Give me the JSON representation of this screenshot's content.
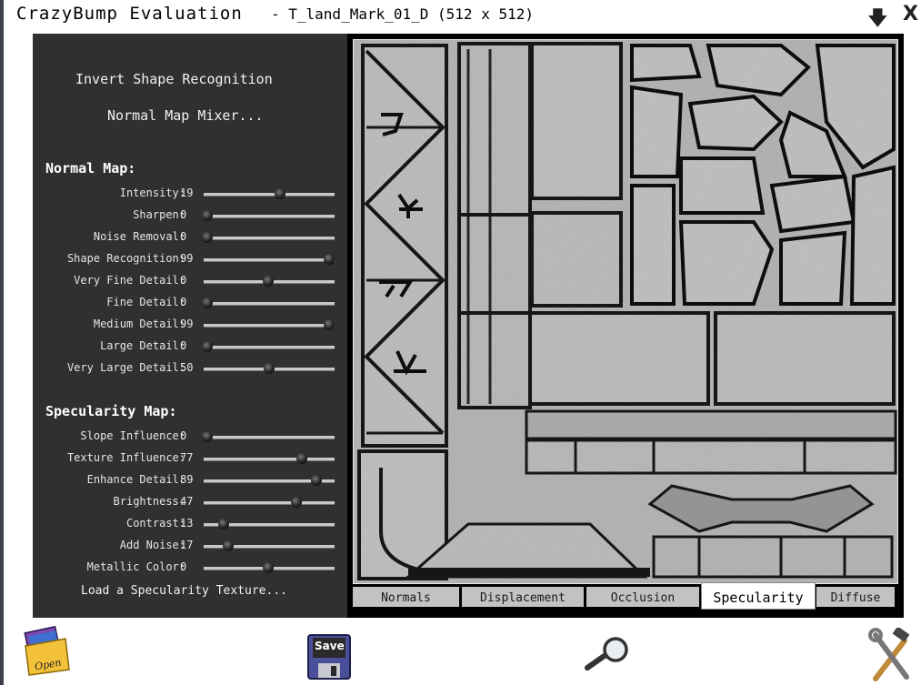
{
  "window": {
    "app_title": "CrazyBump Evaluation",
    "file_title": "- T_land_Mark_01_D (512 x 512)",
    "minimize_glyph": "🡇",
    "close_glyph": "X"
  },
  "menu": {
    "invert_label": "Invert Shape Recognition",
    "mixer_label": "Normal Map Mixer..."
  },
  "normal_map": {
    "title": "Normal Map:",
    "sliders": [
      {
        "label": "Intensity:",
        "value": "19",
        "level": 0.58
      },
      {
        "label": "Sharpen:",
        "value": "0",
        "level": 0.03
      },
      {
        "label": "Noise Removal:",
        "value": "0",
        "level": 0.03
      },
      {
        "label": "Shape Recognition:",
        "value": "99",
        "level": 0.96
      },
      {
        "label": "Very Fine Detail:",
        "value": "0",
        "level": 0.49
      },
      {
        "label": "Fine Detail:",
        "value": "0",
        "level": 0.03
      },
      {
        "label": "Medium Detail:",
        "value": "99",
        "level": 0.96
      },
      {
        "label": "Large Detail:",
        "value": "0",
        "level": 0.03
      },
      {
        "label": "Very Large Detail:",
        "value": "50",
        "level": 0.5
      }
    ]
  },
  "specularity_map": {
    "title": "Specularity Map:",
    "sliders": [
      {
        "label": "Slope Influence:",
        "value": "0",
        "level": 0.03
      },
      {
        "label": "Texture Influence:",
        "value": "77",
        "level": 0.75
      },
      {
        "label": "Enhance Detail:",
        "value": "89",
        "level": 0.86
      },
      {
        "label": "Brightness:",
        "value": "47",
        "level": 0.71
      },
      {
        "label": "Contrast:",
        "value": "13",
        "level": 0.15
      },
      {
        "label": "Add Noise:",
        "value": "17",
        "level": 0.19
      },
      {
        "label": "Metallic Color:",
        "value": "0",
        "level": 0.49
      }
    ],
    "load_label": "Load a Specularity Texture..."
  },
  "tabs": [
    {
      "label": "Normals",
      "active": false
    },
    {
      "label": "Displacement",
      "active": false
    },
    {
      "label": "Occlusion",
      "active": false
    },
    {
      "label": "Specularity",
      "active": true
    },
    {
      "label": "Diffuse",
      "active": false
    }
  ],
  "bottom": {
    "open_label": "Open",
    "save_label": "Save",
    "open_icon": "folder-icon",
    "save_icon": "floppy-disk-icon",
    "zoom_icon": "magnifier-icon",
    "tools_icon": "hammer-wrench-icon"
  },
  "colors": {
    "panel_bg": "#303030",
    "preview_bg": "#c4c4c4",
    "tab_bg": "#c2c2c2",
    "active_tab_bg": "#ffffff"
  }
}
